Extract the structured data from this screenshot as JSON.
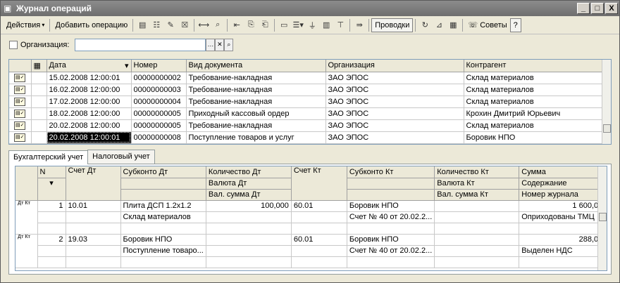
{
  "window": {
    "title": "Журнал операций",
    "controls": [
      "_",
      "□",
      "X"
    ]
  },
  "toolbar": {
    "actions_label": "Действия",
    "add_label": "Добавить операцию",
    "entries_label": "Проводки",
    "advice_label": "Советы",
    "help_label": "?"
  },
  "filter": {
    "label": "Организация:",
    "value": ""
  },
  "journal": {
    "columns": [
      "",
      "Дата",
      "Номер",
      "Вид документа",
      "Организация",
      "Контрагент"
    ],
    "rows": [
      {
        "date": "15.02.2008 12:00:01",
        "number": "00000000002",
        "doc_type": "Требование-накладная",
        "org": "ЗАО ЭПОС",
        "contractor": "Склад материалов"
      },
      {
        "date": "16.02.2008 12:00:00",
        "number": "00000000003",
        "doc_type": "Требование-накладная",
        "org": "ЗАО ЭПОС",
        "contractor": "Склад материалов"
      },
      {
        "date": "17.02.2008 12:00:00",
        "number": "00000000004",
        "doc_type": "Требование-накладная",
        "org": "ЗАО ЭПОС",
        "contractor": "Склад материалов"
      },
      {
        "date": "18.02.2008 12:00:00",
        "number": "00000000005",
        "doc_type": "Приходный кассовый ордер",
        "org": "ЗАО ЭПОС",
        "contractor": "Крохин Дмитрий Юрьевич"
      },
      {
        "date": "20.02.2008 12:00:00",
        "number": "00000000005",
        "doc_type": "Требование-накладная",
        "org": "ЗАО ЭПОС",
        "contractor": "Склад материалов"
      },
      {
        "date": "20.02.2008 12:00:01",
        "number": "00000000008",
        "doc_type": "Поступление товаров и услуг",
        "org": "ЗАО ЭПОС",
        "contractor": "Боровик НПО"
      }
    ]
  },
  "tabs": [
    "Бухгалтерский учет",
    "Налоговый учет"
  ],
  "entries": {
    "headers": {
      "n": "N",
      "dt_account": "Счет Дт",
      "sub_dt": "Субконто Дт",
      "qty_dt": "Количество Дт",
      "cur_dt": "Валюта Дт",
      "cursum_dt": "Вал. сумма Дт",
      "kt_account": "Счет Кт",
      "sub_kt": "Субконто Кт",
      "qty_kt": "Количество Кт",
      "cur_kt": "Валюта Кт",
      "cursum_kt": "Вал. сумма Кт",
      "sum": "Сумма",
      "content": "Содержание",
      "journal_no": "Номер журнала"
    },
    "icon_label": "Дт Кт",
    "rows": [
      {
        "n": "1",
        "dt": "10.01",
        "sub_dt_1": "Плита ДСП 1.2x1.2",
        "sub_dt_2": "Склад материалов",
        "qty_dt": "100,000",
        "kt": "60.01",
        "sub_kt_1": "Боровик НПО",
        "sub_kt_2": "Счет № 40 от 20.02.2...",
        "sum": "1 600,00",
        "content": "Оприходованы ТМЦ"
      },
      {
        "n": "2",
        "dt": "19.03",
        "sub_dt_1": "Боровик НПО",
        "sub_dt_2": "Поступление товаро...",
        "qty_dt": "",
        "kt": "60.01",
        "sub_kt_1": "Боровик НПО",
        "sub_kt_2": "Счет № 40 от 20.02.2...",
        "sum": "288,00",
        "content": "Выделен НДС"
      }
    ]
  }
}
